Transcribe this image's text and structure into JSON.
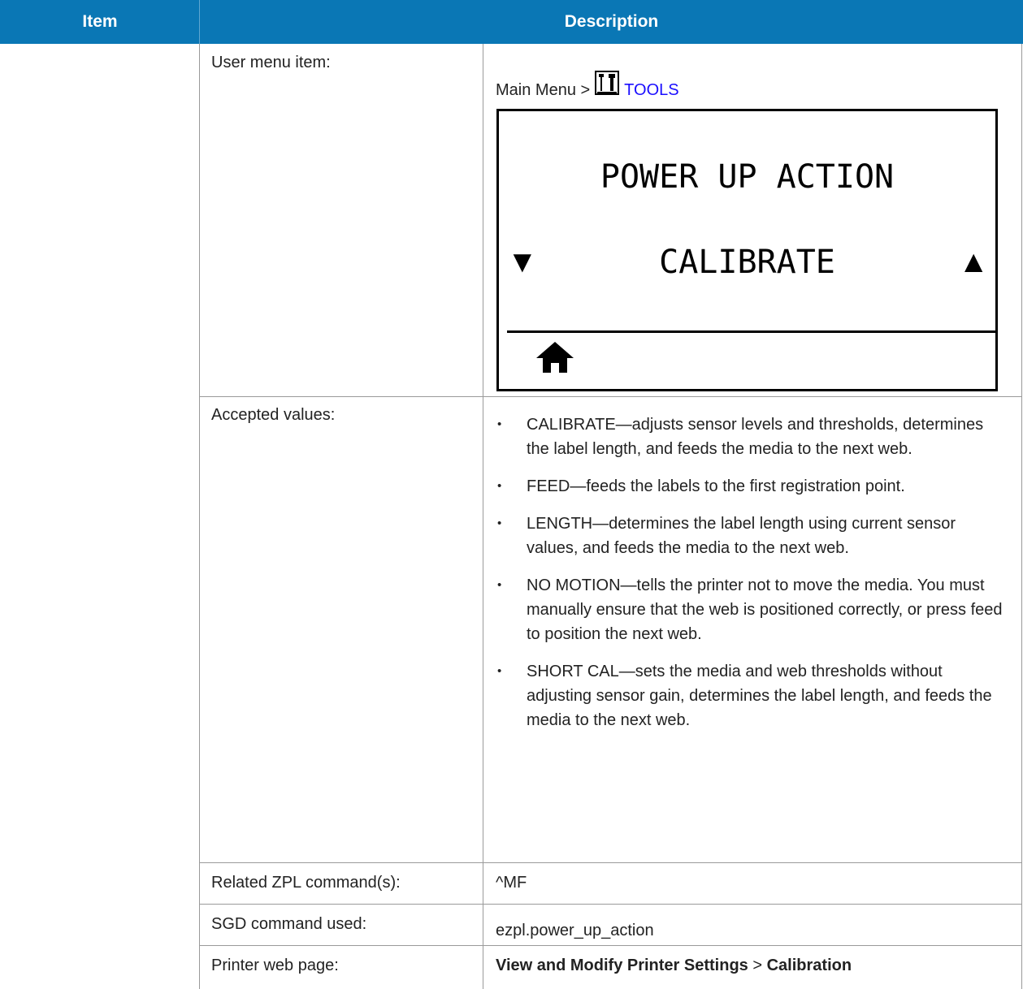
{
  "header": {
    "item": "Item",
    "description": "Description"
  },
  "user_menu": {
    "label": "User menu item:",
    "path_prefix": "Main Menu >",
    "path_link": "TOOLS",
    "icon": "tools-icon"
  },
  "lcd": {
    "title": "POWER UP ACTION",
    "value": "CALIBRATE",
    "prev_icon": "down-triangle-icon",
    "next_icon": "up-triangle-icon",
    "home_icon": "home-icon"
  },
  "accepted": {
    "label": "Accepted values:",
    "items": [
      "CALIBRATE—adjusts sensor levels and thresholds, determines the label length, and feeds the media to the next web.",
      "FEED—feeds the labels to the first registration point.",
      "LENGTH—determines the label length using current sensor values, and feeds the media to the next web.",
      "NO MOTION—tells the printer not to move the media. You must manually ensure that the web is positioned correctly, or press feed to position the next web.",
      "SHORT CAL—sets the media and web thresholds without adjusting sensor gain, determines the label length, and feeds the media to the next web."
    ]
  },
  "zpl": {
    "label": "Related ZPL command(s):",
    "value": "^MF"
  },
  "sgd": {
    "label": "SGD command used:",
    "value": "ezpl.power_up_action"
  },
  "web_page": {
    "label": "Printer web page:",
    "part1": "View and Modify Printer Settings",
    "sep": ">",
    "part2": "Calibration"
  },
  "colors": {
    "header_bg": "#0a77b5",
    "link": "#1a0dff",
    "border": "#9a9a9a"
  }
}
